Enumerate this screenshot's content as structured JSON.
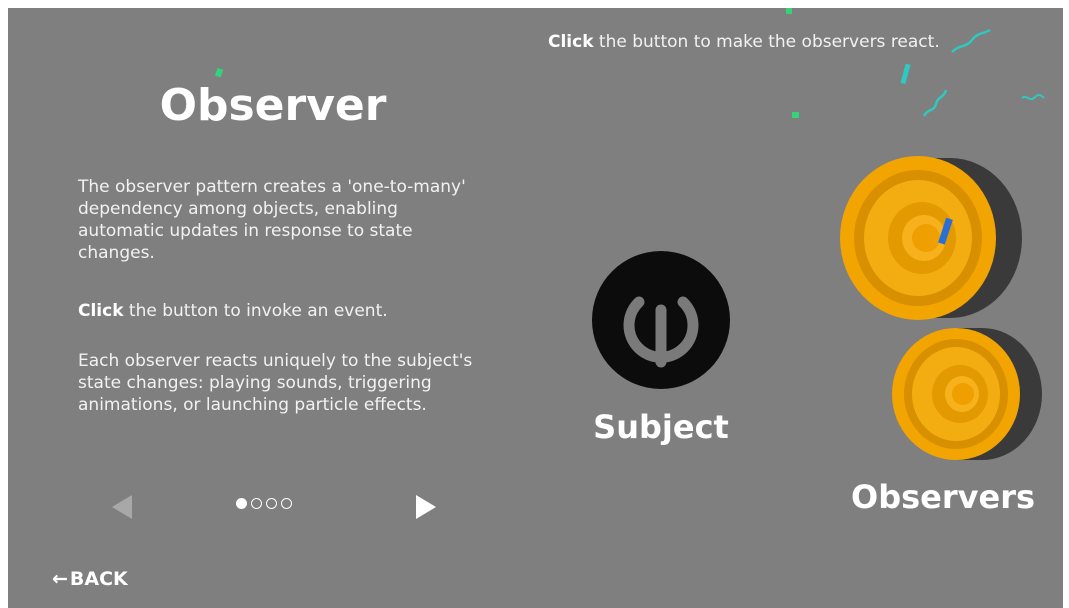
{
  "left_panel": {
    "title": "Observer",
    "paragraph_1": "The observer pattern creates a 'one-to-many' dependency among objects, enabling automatic updates in response to state changes.",
    "paragraph_2_bold": "Click",
    "paragraph_2_rest": " the button to invoke an event.",
    "paragraph_3": "Each observer reacts uniquely to the subject's state changes: playing sounds, triggering animations, or launching particle effects."
  },
  "pagination": {
    "current_page": 1,
    "total_pages": 4,
    "prev_icon": "left-triangle-icon",
    "next_icon": "right-triangle-icon"
  },
  "back": {
    "arrow": "←",
    "label": "BACK"
  },
  "right_panel": {
    "instruction_bold": "Click",
    "instruction_rest": " the button to make the observers react.",
    "subject_label": "Subject",
    "observers_label": "Observers",
    "subject_icon": "power-icon",
    "observer_icon": "speaker-icon"
  },
  "colors": {
    "background": "#7f7f7f",
    "speaker_orange": "#f2a400",
    "speaker_body": "#3a3a3a",
    "confetti_teal": "#2ec9c0",
    "confetti_green": "#35d27a",
    "confetti_blue": "#2a6fd6"
  }
}
